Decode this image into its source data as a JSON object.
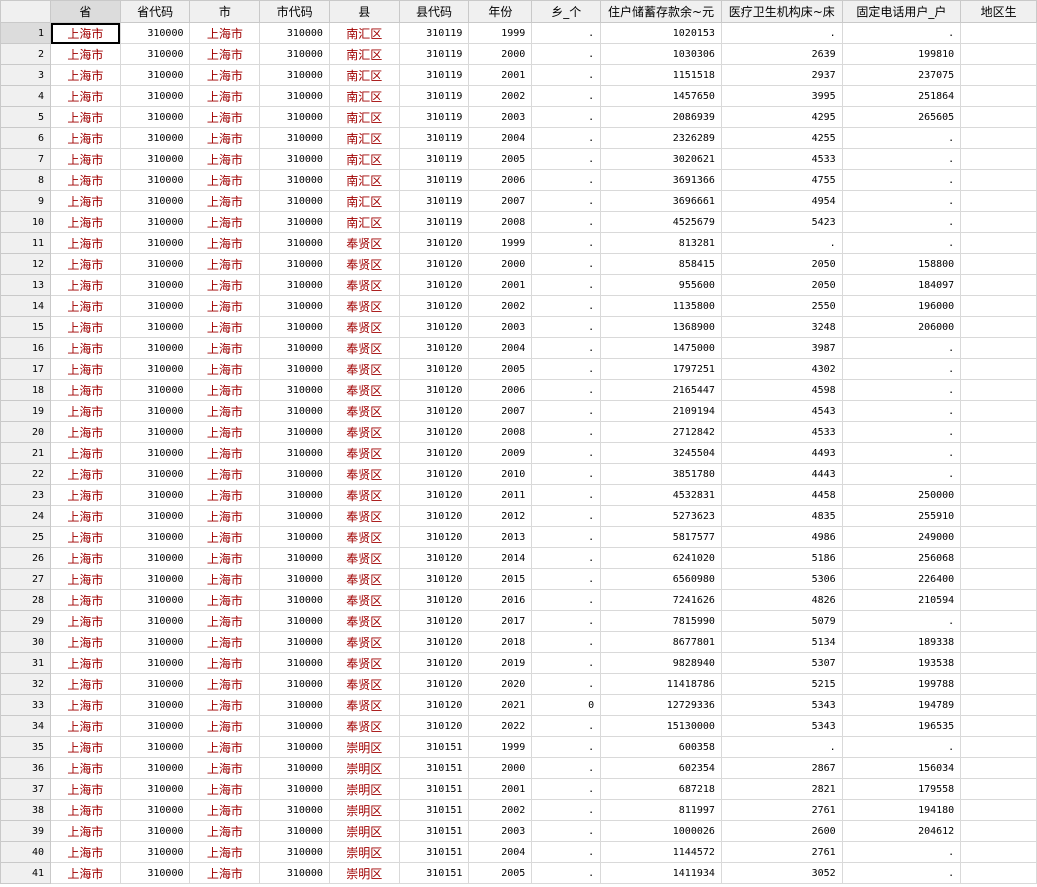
{
  "columns": [
    "省",
    "省代码",
    "市",
    "市代码",
    "县",
    "县代码",
    "年份",
    "乡_个",
    "住户储蓄存款余~元",
    "医疗卫生机构床~床",
    "固定电话用户_户",
    "地区生"
  ],
  "rows": [
    [
      "1",
      "上海市",
      "310000",
      "上海市",
      "310000",
      "南汇区",
      "310119",
      "1999",
      ".",
      "1020153",
      ".",
      "."
    ],
    [
      "2",
      "上海市",
      "310000",
      "上海市",
      "310000",
      "南汇区",
      "310119",
      "2000",
      ".",
      "1030306",
      "2639",
      "199810"
    ],
    [
      "3",
      "上海市",
      "310000",
      "上海市",
      "310000",
      "南汇区",
      "310119",
      "2001",
      ".",
      "1151518",
      "2937",
      "237075"
    ],
    [
      "4",
      "上海市",
      "310000",
      "上海市",
      "310000",
      "南汇区",
      "310119",
      "2002",
      ".",
      "1457650",
      "3995",
      "251864"
    ],
    [
      "5",
      "上海市",
      "310000",
      "上海市",
      "310000",
      "南汇区",
      "310119",
      "2003",
      ".",
      "2086939",
      "4295",
      "265605"
    ],
    [
      "6",
      "上海市",
      "310000",
      "上海市",
      "310000",
      "南汇区",
      "310119",
      "2004",
      ".",
      "2326289",
      "4255",
      "."
    ],
    [
      "7",
      "上海市",
      "310000",
      "上海市",
      "310000",
      "南汇区",
      "310119",
      "2005",
      ".",
      "3020621",
      "4533",
      "."
    ],
    [
      "8",
      "上海市",
      "310000",
      "上海市",
      "310000",
      "南汇区",
      "310119",
      "2006",
      ".",
      "3691366",
      "4755",
      "."
    ],
    [
      "9",
      "上海市",
      "310000",
      "上海市",
      "310000",
      "南汇区",
      "310119",
      "2007",
      ".",
      "3696661",
      "4954",
      "."
    ],
    [
      "10",
      "上海市",
      "310000",
      "上海市",
      "310000",
      "南汇区",
      "310119",
      "2008",
      ".",
      "4525679",
      "5423",
      "."
    ],
    [
      "11",
      "上海市",
      "310000",
      "上海市",
      "310000",
      "奉贤区",
      "310120",
      "1999",
      ".",
      "813281",
      ".",
      "."
    ],
    [
      "12",
      "上海市",
      "310000",
      "上海市",
      "310000",
      "奉贤区",
      "310120",
      "2000",
      ".",
      "858415",
      "2050",
      "158800"
    ],
    [
      "13",
      "上海市",
      "310000",
      "上海市",
      "310000",
      "奉贤区",
      "310120",
      "2001",
      ".",
      "955600",
      "2050",
      "184097"
    ],
    [
      "14",
      "上海市",
      "310000",
      "上海市",
      "310000",
      "奉贤区",
      "310120",
      "2002",
      ".",
      "1135800",
      "2550",
      "196000"
    ],
    [
      "15",
      "上海市",
      "310000",
      "上海市",
      "310000",
      "奉贤区",
      "310120",
      "2003",
      ".",
      "1368900",
      "3248",
      "206000"
    ],
    [
      "16",
      "上海市",
      "310000",
      "上海市",
      "310000",
      "奉贤区",
      "310120",
      "2004",
      ".",
      "1475000",
      "3987",
      "."
    ],
    [
      "17",
      "上海市",
      "310000",
      "上海市",
      "310000",
      "奉贤区",
      "310120",
      "2005",
      ".",
      "1797251",
      "4302",
      "."
    ],
    [
      "18",
      "上海市",
      "310000",
      "上海市",
      "310000",
      "奉贤区",
      "310120",
      "2006",
      ".",
      "2165447",
      "4598",
      "."
    ],
    [
      "19",
      "上海市",
      "310000",
      "上海市",
      "310000",
      "奉贤区",
      "310120",
      "2007",
      ".",
      "2109194",
      "4543",
      "."
    ],
    [
      "20",
      "上海市",
      "310000",
      "上海市",
      "310000",
      "奉贤区",
      "310120",
      "2008",
      ".",
      "2712842",
      "4533",
      "."
    ],
    [
      "21",
      "上海市",
      "310000",
      "上海市",
      "310000",
      "奉贤区",
      "310120",
      "2009",
      ".",
      "3245504",
      "4493",
      "."
    ],
    [
      "22",
      "上海市",
      "310000",
      "上海市",
      "310000",
      "奉贤区",
      "310120",
      "2010",
      ".",
      "3851780",
      "4443",
      "."
    ],
    [
      "23",
      "上海市",
      "310000",
      "上海市",
      "310000",
      "奉贤区",
      "310120",
      "2011",
      ".",
      "4532831",
      "4458",
      "250000"
    ],
    [
      "24",
      "上海市",
      "310000",
      "上海市",
      "310000",
      "奉贤区",
      "310120",
      "2012",
      ".",
      "5273623",
      "4835",
      "255910"
    ],
    [
      "25",
      "上海市",
      "310000",
      "上海市",
      "310000",
      "奉贤区",
      "310120",
      "2013",
      ".",
      "5817577",
      "4986",
      "249000"
    ],
    [
      "26",
      "上海市",
      "310000",
      "上海市",
      "310000",
      "奉贤区",
      "310120",
      "2014",
      ".",
      "6241020",
      "5186",
      "256068"
    ],
    [
      "27",
      "上海市",
      "310000",
      "上海市",
      "310000",
      "奉贤区",
      "310120",
      "2015",
      ".",
      "6560980",
      "5306",
      "226400"
    ],
    [
      "28",
      "上海市",
      "310000",
      "上海市",
      "310000",
      "奉贤区",
      "310120",
      "2016",
      ".",
      "7241626",
      "4826",
      "210594"
    ],
    [
      "29",
      "上海市",
      "310000",
      "上海市",
      "310000",
      "奉贤区",
      "310120",
      "2017",
      ".",
      "7815990",
      "5079",
      "."
    ],
    [
      "30",
      "上海市",
      "310000",
      "上海市",
      "310000",
      "奉贤区",
      "310120",
      "2018",
      ".",
      "8677801",
      "5134",
      "189338"
    ],
    [
      "31",
      "上海市",
      "310000",
      "上海市",
      "310000",
      "奉贤区",
      "310120",
      "2019",
      ".",
      "9828940",
      "5307",
      "193538"
    ],
    [
      "32",
      "上海市",
      "310000",
      "上海市",
      "310000",
      "奉贤区",
      "310120",
      "2020",
      ".",
      "11418786",
      "5215",
      "199788"
    ],
    [
      "33",
      "上海市",
      "310000",
      "上海市",
      "310000",
      "奉贤区",
      "310120",
      "2021",
      "0",
      "12729336",
      "5343",
      "194789"
    ],
    [
      "34",
      "上海市",
      "310000",
      "上海市",
      "310000",
      "奉贤区",
      "310120",
      "2022",
      ".",
      "15130000",
      "5343",
      "196535"
    ],
    [
      "35",
      "上海市",
      "310000",
      "上海市",
      "310000",
      "崇明区",
      "310151",
      "1999",
      ".",
      "600358",
      ".",
      "."
    ],
    [
      "36",
      "上海市",
      "310000",
      "上海市",
      "310000",
      "崇明区",
      "310151",
      "2000",
      ".",
      "602354",
      "2867",
      "156034"
    ],
    [
      "37",
      "上海市",
      "310000",
      "上海市",
      "310000",
      "崇明区",
      "310151",
      "2001",
      ".",
      "687218",
      "2821",
      "179558"
    ],
    [
      "38",
      "上海市",
      "310000",
      "上海市",
      "310000",
      "崇明区",
      "310151",
      "2002",
      ".",
      "811997",
      "2761",
      "194180"
    ],
    [
      "39",
      "上海市",
      "310000",
      "上海市",
      "310000",
      "崇明区",
      "310151",
      "2003",
      ".",
      "1000026",
      "2600",
      "204612"
    ],
    [
      "40",
      "上海市",
      "310000",
      "上海市",
      "310000",
      "崇明区",
      "310151",
      "2004",
      ".",
      "1144572",
      "2761",
      "."
    ],
    [
      "41",
      "上海市",
      "310000",
      "上海市",
      "310000",
      "崇明区",
      "310151",
      "2005",
      ".",
      "1411934",
      "3052",
      "."
    ]
  ]
}
